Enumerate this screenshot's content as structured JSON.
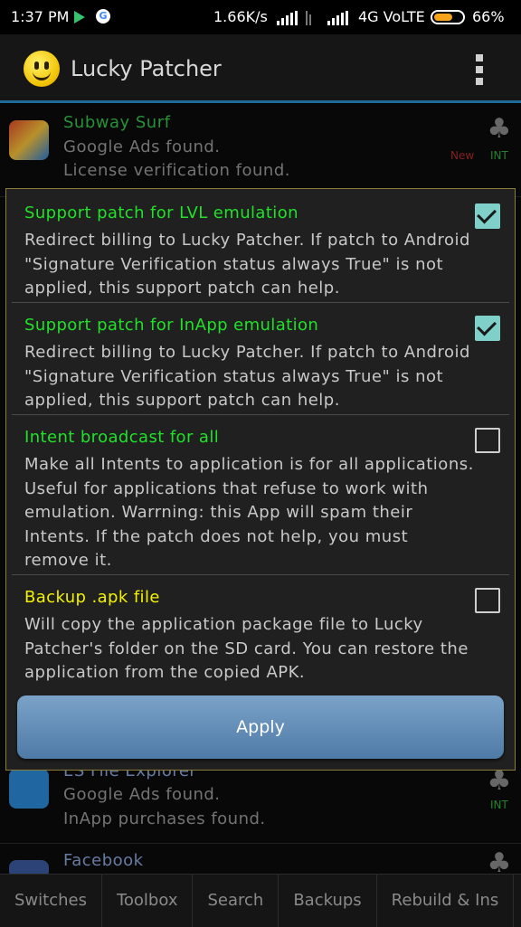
{
  "status_bar": {
    "time": "1:37 PM",
    "speed": "1.66K/s",
    "network": "4G VoLTE",
    "battery": "66%",
    "battery_level": 0.66
  },
  "app_bar": {
    "title": "Lucky Patcher",
    "logo_icon": "smiley-icon",
    "menu_icon": "overflow-menu-icon"
  },
  "app_list": [
    {
      "name": "Subway Surf",
      "name_color": "#33c24a",
      "lines": [
        "Google Ads found.",
        "License verification found."
      ],
      "badges": [
        "New",
        "INT"
      ]
    },
    {
      "name": "ES File Explorer",
      "name_color": "#8aa4d8",
      "lines": [
        "Google Ads found.",
        "InApp purchases found."
      ],
      "badges": [
        "INT"
      ]
    },
    {
      "name": "Facebook",
      "name_color": "#8aa4d8",
      "lines": [],
      "badges": []
    }
  ],
  "dialog": {
    "options": [
      {
        "title": "Support patch for LVL emulation",
        "description": "Redirect billing to Lucky Patcher. If patch to Android \"Signature Verification status always True\" is not applied, this support patch can help.",
        "checked": true
      },
      {
        "title": "Support patch for InApp emulation",
        "description": "Redirect billing to Lucky Patcher. If patch to Android \"Signature Verification status always True\" is not applied, this support patch can help.",
        "checked": true
      },
      {
        "title": "Intent broadcast for all",
        "description": "Make all Intents to application is for all applications. Useful for applications that refuse to work with emulation. Warrning: this App will spam their Intents. If the patch does not help, you must remove it.",
        "checked": false
      },
      {
        "title": "Backup .apk file",
        "description": "Will copy the application package file to Lucky Patcher's folder on the SD card. You can restore the application from the copied APK.",
        "checked": false
      }
    ],
    "apply_label": "Apply"
  },
  "bottom_tabs": [
    "Switches",
    "Toolbox",
    "Search",
    "Backups",
    "Rebuild & Ins"
  ],
  "colors": {
    "option_title_green": "#22e02a",
    "option_title_yellow": "#f2f200",
    "checkbox_on": "#7fd0c8",
    "accent_blue": "#1f6a96",
    "new_badge": "#b12b2b",
    "int_badge": "#2fae3b"
  }
}
